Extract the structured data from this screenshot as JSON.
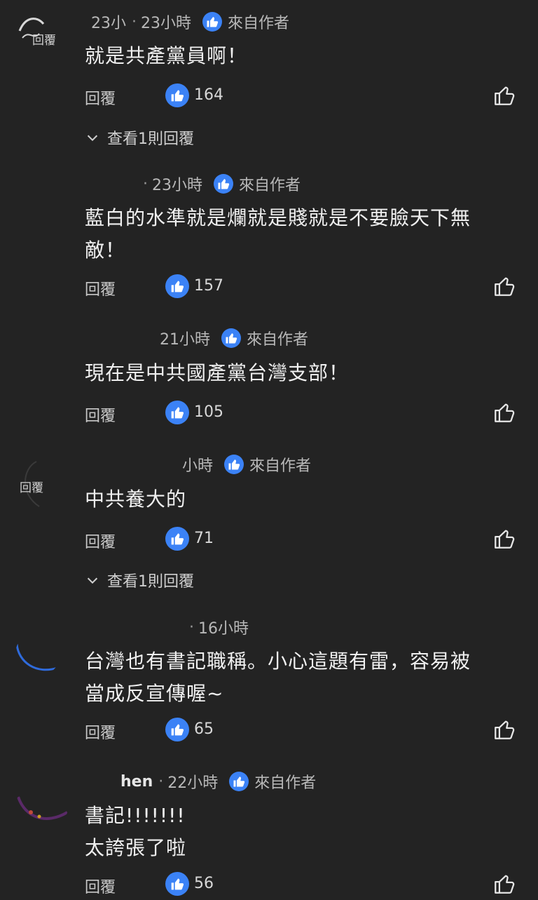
{
  "reply_label": "回覆",
  "author_badge_label": "來自作者",
  "view_replies_label": "查看1則回覆",
  "comments": [
    {
      "name": "23小",
      "time": "23小時",
      "from_author": true,
      "text_lines": [
        "就是共產黨員啊！"
      ],
      "likes": "164",
      "has_replies": true,
      "avatar_text": "回覆"
    },
    {
      "name": "",
      "time": "23小時",
      "from_author": true,
      "text_lines": [
        "藍白的水準就是爛就是賤就是不要臉天下無",
        "敵！"
      ],
      "likes": "157",
      "has_replies": false
    },
    {
      "name": "",
      "time": "21小時",
      "from_author": true,
      "text_lines": [
        "現在是中共國產黨台灣支部！"
      ],
      "likes": "105",
      "has_replies": false
    },
    {
      "name": "",
      "time": "小時",
      "from_author": true,
      "text_lines": [
        "中共養大的"
      ],
      "likes": "71",
      "has_replies": true,
      "avatar_text": "回覆"
    },
    {
      "name": "",
      "time": "16小時",
      "from_author": false,
      "text_lines": [
        "台灣也有書記職稱。小心這題有雷，容易被",
        "當成反宣傳喔~"
      ],
      "likes": "65",
      "has_replies": false
    },
    {
      "name": "hen",
      "time": "22小時",
      "from_author": true,
      "text_lines": [
        "書記!!!!!!!",
        "太誇張了啦"
      ],
      "likes": "56",
      "has_replies": false
    }
  ]
}
